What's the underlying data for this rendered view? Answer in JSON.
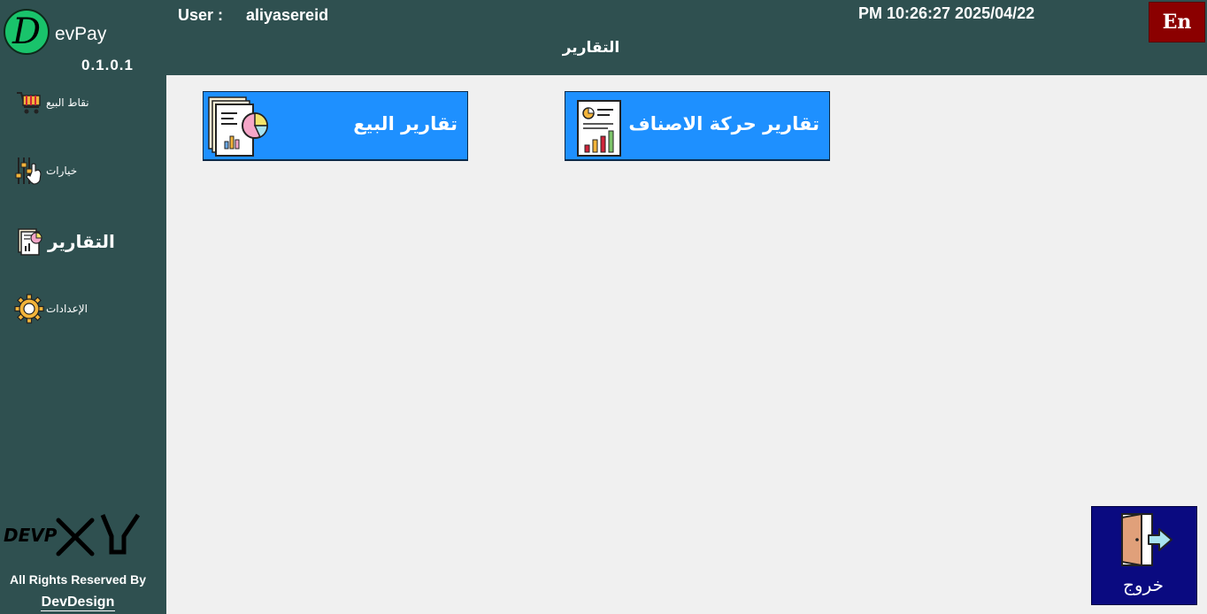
{
  "app": {
    "logo_letter": "D",
    "name": "evPay",
    "version": "0.1.0.1"
  },
  "header": {
    "user_label": "User :",
    "user_name": "aliyasereid",
    "datetime": "PM 10:26:27 2025/04/22",
    "page_title": "التقارير",
    "lang_button": "En"
  },
  "sidebar": {
    "items": [
      {
        "label": "نقاط البيع",
        "icon": "shopping-cart-icon",
        "active": false
      },
      {
        "label": "خيارات",
        "icon": "sliders-hand-icon",
        "active": false
      },
      {
        "label": "التقارير",
        "icon": "report-icon",
        "active": true
      },
      {
        "label": "الإعدادات",
        "icon": "gear-icon",
        "active": false
      }
    ],
    "brand_text": "DEVP",
    "rights": "All Rights Reserved By",
    "company": "DevDesign"
  },
  "main": {
    "reports": [
      {
        "label": "تقارير حركة الاصناف",
        "icon": "item-movement-report-icon"
      },
      {
        "label": "تقارير البيع",
        "icon": "sales-report-icon"
      }
    ]
  },
  "exit": {
    "label": "خروج",
    "icon": "exit-door-icon"
  },
  "colors": {
    "sidebar_bg": "#2f5050",
    "content_bg": "#f0f0f0",
    "button_blue": "#1e90ff",
    "lang_red": "#8b0000",
    "exit_navy": "#0a0a80",
    "logo_green": "#19c36b"
  }
}
